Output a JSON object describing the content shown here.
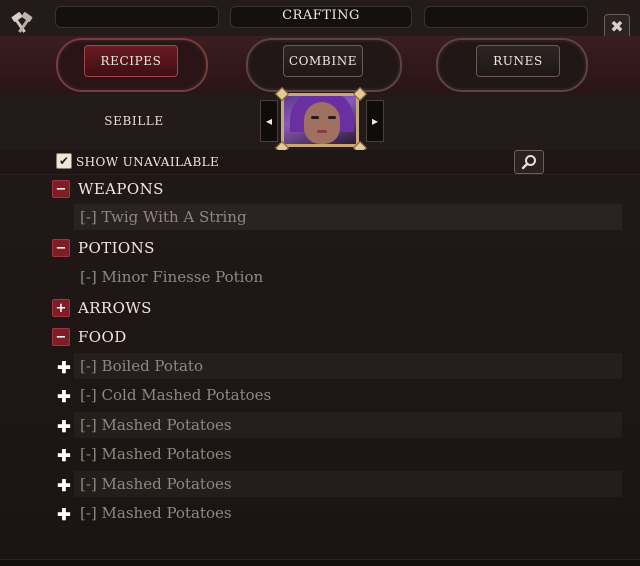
{
  "window": {
    "title": "CRAFTING",
    "close_glyph": "✖"
  },
  "tabs": [
    {
      "label": "RECIPES",
      "active": true
    },
    {
      "label": "COMBINE",
      "active": false
    },
    {
      "label": "RUNES",
      "active": false
    }
  ],
  "character": {
    "name": "SEBILLE",
    "prev_glyph": "◂",
    "next_glyph": "▸"
  },
  "filter": {
    "show_unavailable_label": "SHOW UNAVAILABLE",
    "show_unavailable_checked": true,
    "check_glyph": "✔"
  },
  "categories": [
    {
      "label": "WEAPONS",
      "state": "−"
    },
    {
      "label": "POTIONS",
      "state": "−"
    },
    {
      "label": "ARROWS",
      "state": "+"
    },
    {
      "label": "FOOD",
      "state": "−"
    }
  ],
  "recipes": {
    "weapons": [
      "[-] Twig With A String"
    ],
    "potions": [
      "[-] Minor Finesse Potion"
    ],
    "food": [
      "[-] Boiled Potato",
      "[-] Cold Mashed Potatoes",
      "[-] Mashed Potatoes",
      "[-] Mashed Potatoes",
      "[-] Mashed Potatoes",
      "[-] Mashed Potatoes"
    ]
  },
  "icons": {
    "hammer": "hammer-icon",
    "close": "close-icon",
    "search": "search-icon",
    "expand": "plus-icon",
    "collapse": "minus-icon"
  },
  "colors": {
    "accent_red": "#7e1d26",
    "frame_gold": "#c6a779",
    "text_light": "#efe7dc",
    "text_dim": "#8f8781"
  }
}
